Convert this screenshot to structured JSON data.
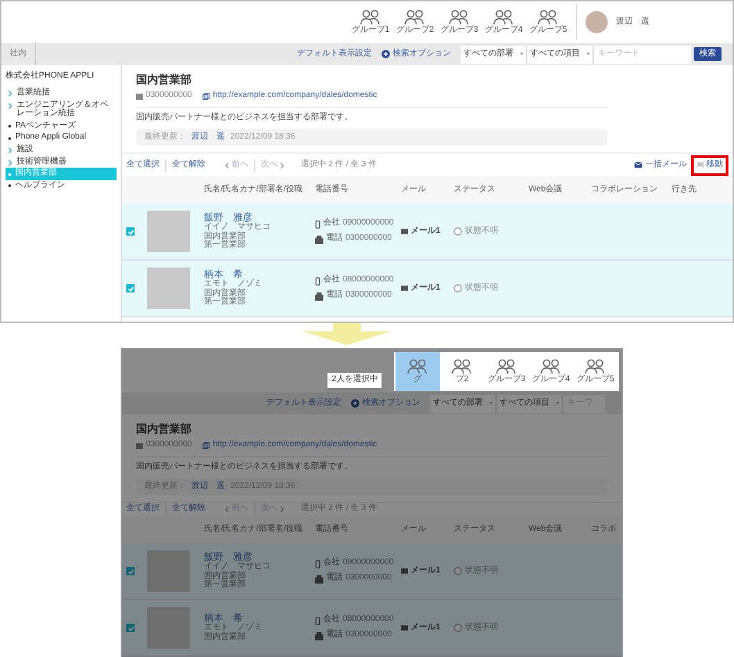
{
  "top": {
    "groups": [
      {
        "label": "グループ1",
        "selected": false
      },
      {
        "label": "グループ2",
        "selected": false
      },
      {
        "label": "グループ3",
        "selected": false
      },
      {
        "label": "グループ4",
        "selected": false
      },
      {
        "label": "グループ5",
        "selected": false
      }
    ],
    "user": {
      "name": "渡辺　遥"
    },
    "breadcrumb": "社内",
    "search": {
      "default_link": "デフォルト表示設定",
      "options": "検索オプション",
      "department": "すべての部署",
      "field": "すべての項目",
      "placeholder": "キーワード",
      "button": "検索"
    },
    "sidebar": {
      "company": "株式会社PHONE APPLI",
      "items": [
        {
          "label": "営業統括",
          "kind": "folder",
          "selected": false
        },
        {
          "label": "エンジニアリング＆オペレーション統括",
          "kind": "folder",
          "selected": false
        },
        {
          "label": "PAベンチャーズ",
          "kind": "leaf",
          "selected": false
        },
        {
          "label": "Phone Appli Global",
          "kind": "leaf",
          "selected": false
        },
        {
          "label": "施設",
          "kind": "folder",
          "selected": false
        },
        {
          "label": "技術管理機器",
          "kind": "folder",
          "selected": false
        },
        {
          "label": "国内営業部",
          "kind": "leaf",
          "selected": true
        },
        {
          "label": "ヘルプライン",
          "kind": "leaf",
          "selected": false
        }
      ]
    },
    "department": {
      "title": "国内営業部",
      "phone": "0300000000",
      "url": "http://example.com/company/dales/domestic",
      "description": "国内販売パートナー様とのビジネスを担当する部署です。",
      "updated_label": "最終更新：",
      "updated_by": "渡辺　遥",
      "updated_at": "2022/12/09 18:36"
    },
    "toolbar": {
      "select_all": "全て選択",
      "clear_all": "全て解除",
      "prev": "前へ",
      "next": "次へ",
      "count": "選択中 2 件 / 全 3 件",
      "bulk_mail": "一括メール",
      "move": {
        "label": "移動",
        "highlighted": true
      }
    },
    "table": {
      "columns": [
        "氏名/氏名カナ/部署名/役職",
        "電話番号",
        "メール",
        "ステータス",
        "Web会議",
        "コラボレーション",
        "行き先"
      ],
      "rows": [
        {
          "checked": true,
          "name": "飯野　雅彦",
          "kana": "イイノ　マサヒコ",
          "department": "国内営業部",
          "section": "第一営業部",
          "phones": [
            {
              "kind": "mobile",
              "label": "会社",
              "number": "09000000000"
            },
            {
              "kind": "office",
              "label": "電話",
              "number": "0300000000"
            }
          ],
          "mail": "メール1",
          "status": "状態不明"
        },
        {
          "checked": true,
          "name": "柄本　希",
          "kana": "エモト　ノゾミ",
          "department": "国内営業部",
          "section": "第一営業部",
          "phones": [
            {
              "kind": "mobile",
              "label": "会社",
              "number": "08000000000"
            },
            {
              "kind": "office",
              "label": "電話",
              "number": "0300000000"
            }
          ],
          "mail": "メール1",
          "status": "状態不明"
        }
      ]
    }
  },
  "bottom": {
    "groups": [
      {
        "label": "グ",
        "selected": true
      },
      {
        "label": "プ2",
        "selected": false
      },
      {
        "label": "グループ3",
        "selected": false
      },
      {
        "label": "グループ4",
        "selected": false
      },
      {
        "label": "グループ5",
        "selected": false
      }
    ],
    "tooltip": "2人を選択中",
    "search": {
      "default_link": "デフォルト表示設定",
      "options": "検索オプション",
      "department": "すべての部署",
      "field": "すべての項目",
      "placeholder": "キーワ"
    },
    "department": {
      "title": "国内営業部",
      "phone": "0300000000",
      "url": "http://example.com/company/dales/domestic",
      "description": "国内販売パートナー様とのビジネスを担当する部署です。",
      "updated_label": "最終更新：",
      "updated_by": "渡辺　遥",
      "updated_at": "2022/12/09 18:36"
    },
    "toolbar": {
      "select_all": "全て選択",
      "clear_all": "全て解除",
      "prev": "前へ",
      "next": "次へ",
      "count": "選択中 2 件 / 全 3 件"
    },
    "table": {
      "columns": [
        "氏名/氏名カナ/部署名/役職",
        "電話番号",
        "メール",
        "ステータス",
        "Web会議",
        "コラボ"
      ],
      "rows": [
        {
          "checked": true,
          "name": "飯野　雅彦",
          "kana": "イイノ　マサヒコ",
          "department": "国内営業部",
          "section": "第一営業部",
          "phones": [
            {
              "kind": "mobile",
              "label": "会社",
              "number": "09000000000"
            },
            {
              "kind": "office",
              "label": "電話",
              "number": "0300000000"
            }
          ],
          "mail": "メール1",
          "status": "状態不明"
        },
        {
          "checked": true,
          "name": "柄本　希",
          "kana": "エモト　ノゾミ",
          "department": "国内営業部",
          "phones": [
            {
              "kind": "mobile",
              "label": "会社",
              "number": "08000000000"
            },
            {
              "kind": "office",
              "label": "電話",
              "number": "0300000000"
            }
          ],
          "mail": "メール1",
          "status": "状態不明"
        }
      ]
    }
  }
}
